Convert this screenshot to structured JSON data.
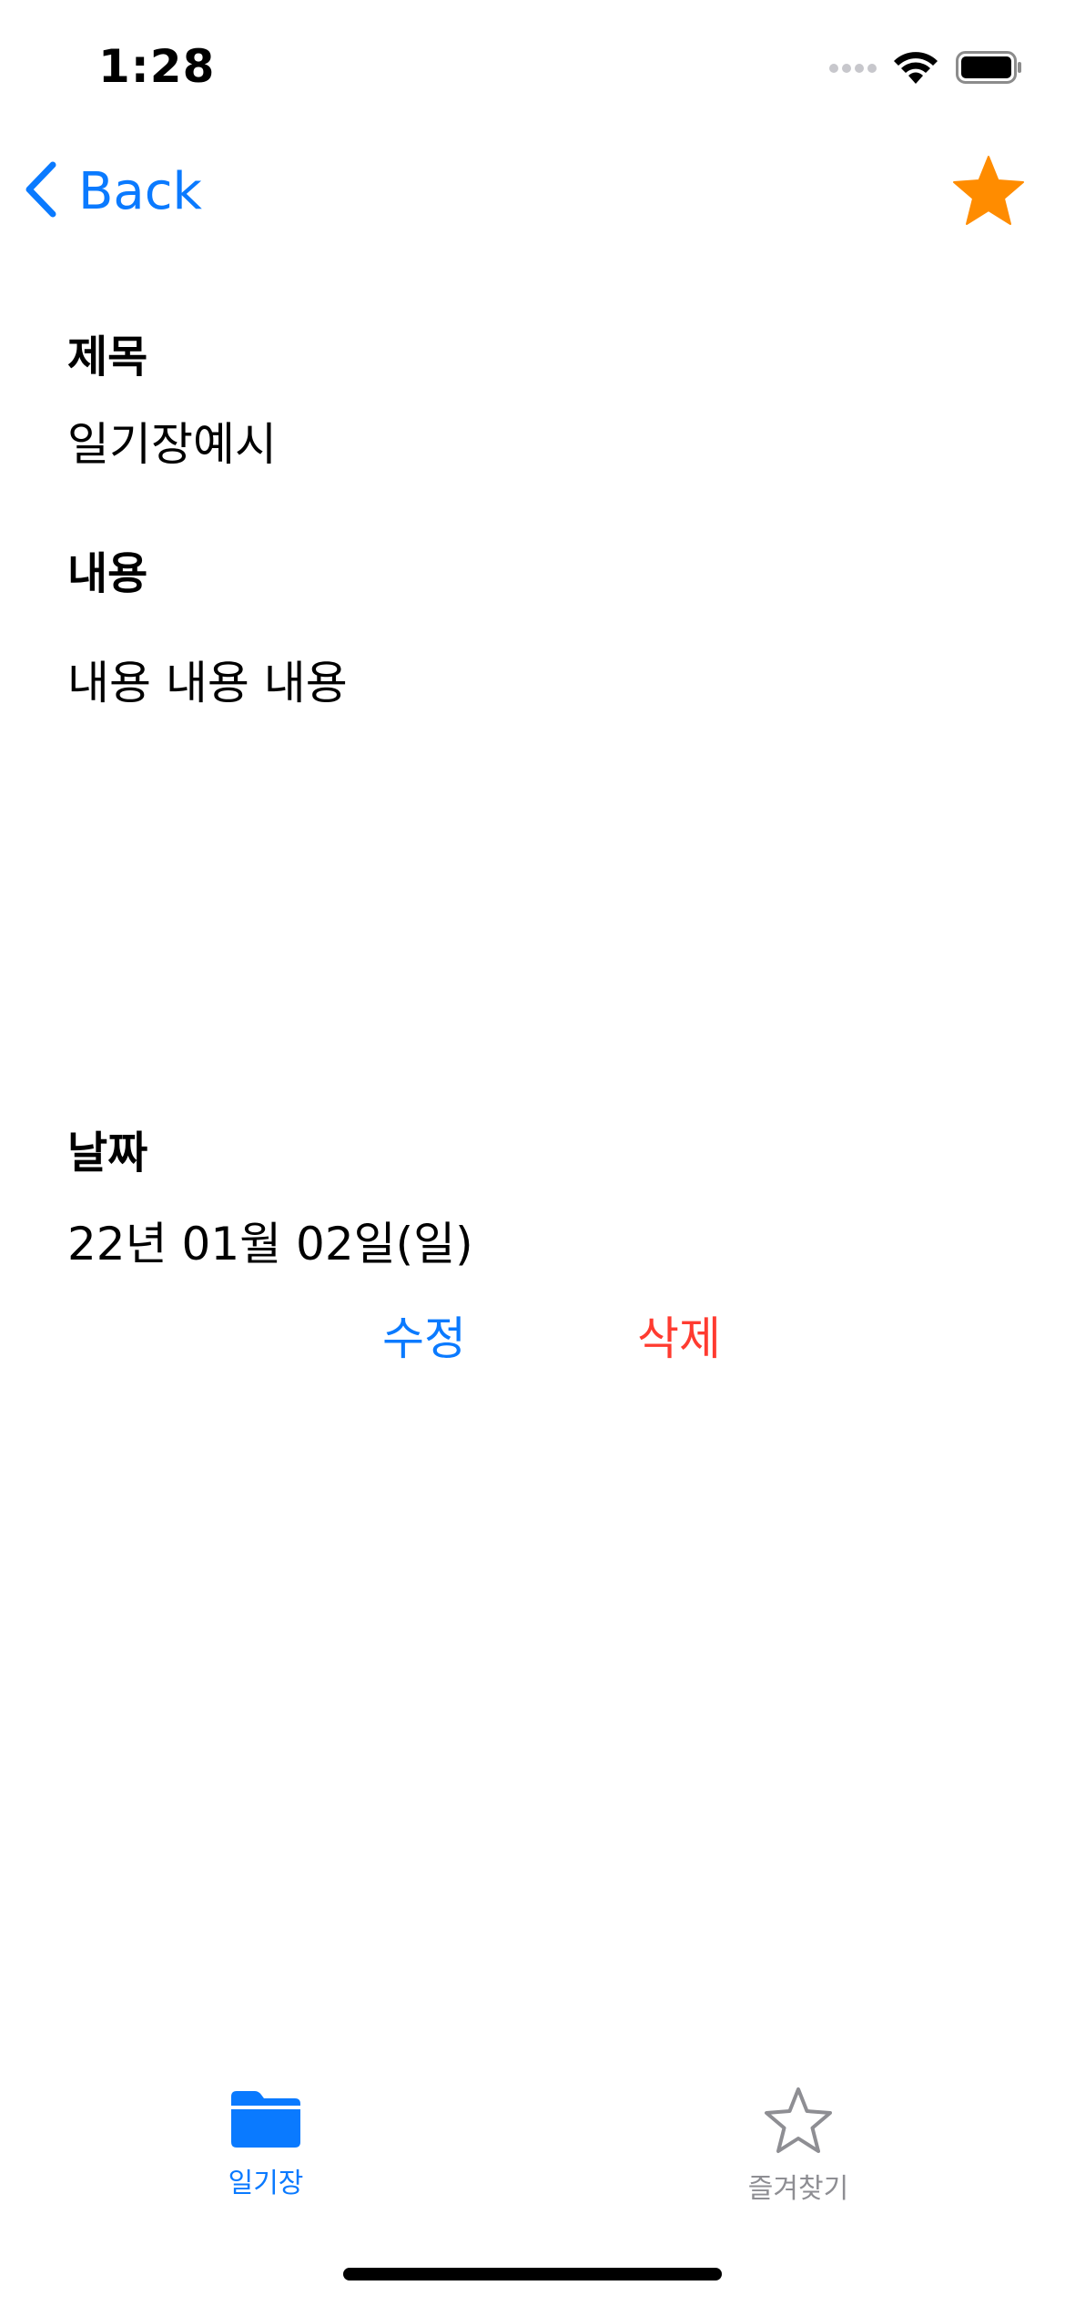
{
  "status_bar": {
    "time": "1:28"
  },
  "nav": {
    "back_label": "Back",
    "favorite_icon": "star-filled-icon",
    "favorite_color": "#ff8c00"
  },
  "detail": {
    "title_label": "제목",
    "title_value": "일기장예시",
    "content_label": "내용",
    "content_value": "내용 내용 내용",
    "date_label": "날짜",
    "date_value": "22년 01월 02일(일)"
  },
  "actions": {
    "edit_label": "수정",
    "delete_label": "삭제"
  },
  "tab_bar": {
    "tabs": [
      {
        "label": "일기장",
        "icon": "folder-icon",
        "selected": true
      },
      {
        "label": "즐겨찾기",
        "icon": "star-outline-icon",
        "selected": false
      }
    ]
  },
  "colors": {
    "accent": "#0a7aff",
    "destructive": "#ff3b30",
    "inactive": "#8e8e93"
  }
}
